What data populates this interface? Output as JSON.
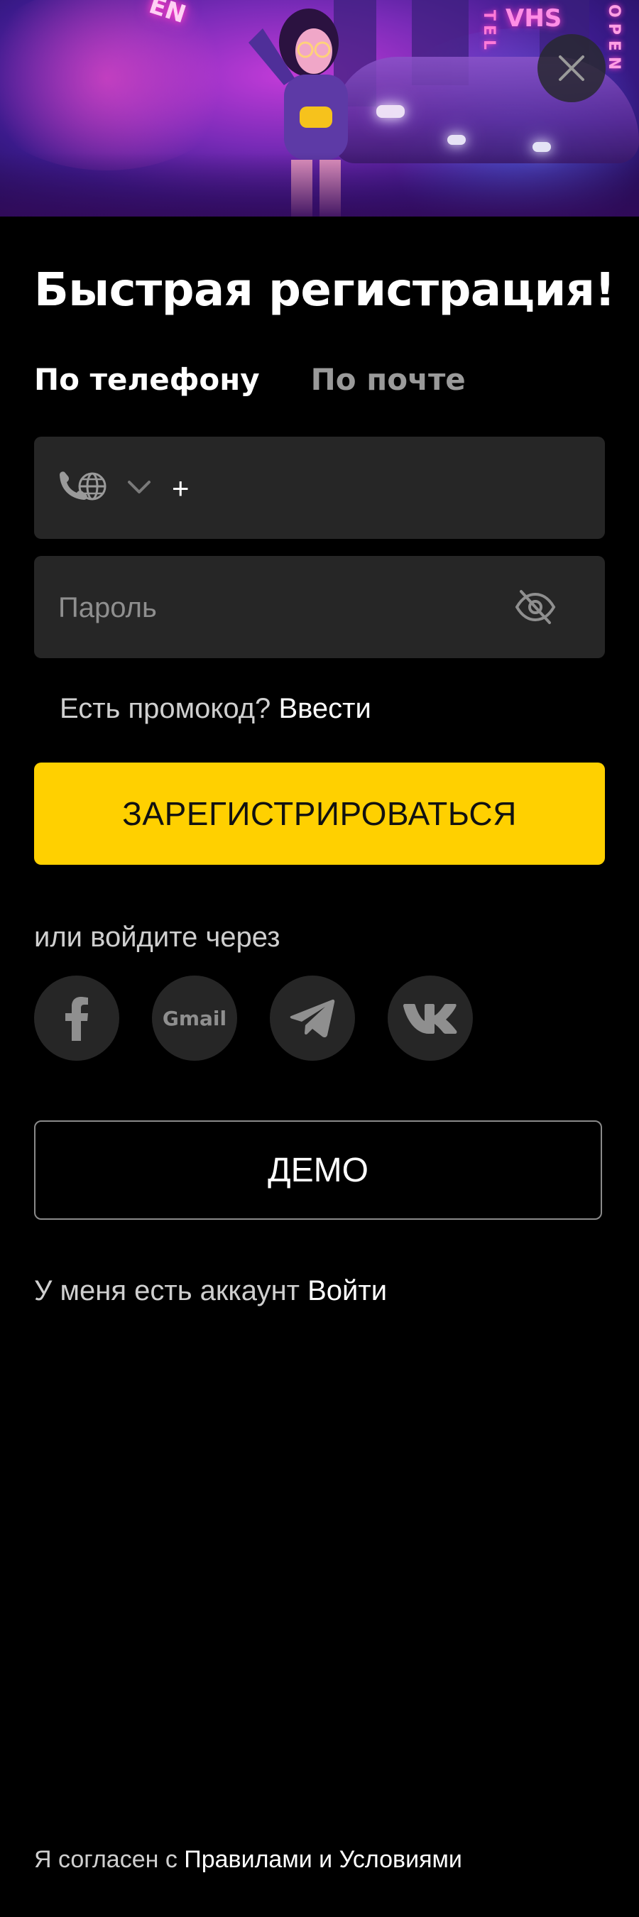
{
  "banner": {
    "neon_signs": [
      "EN",
      "VHS",
      "TEL",
      "OPEN"
    ]
  },
  "form": {
    "title": "Быстрая регистрация!",
    "tabs": [
      {
        "label": "По телефону",
        "active": true
      },
      {
        "label": "По почте",
        "active": false
      }
    ],
    "phone": {
      "value": "+",
      "icon": "phone-globe-icon"
    },
    "password": {
      "placeholder": "Пароль",
      "icon": "eye-off-icon"
    },
    "promo": {
      "question": "Есть промокод?",
      "link": "Ввести"
    },
    "register_label": "ЗАРЕГИСТРИРОВАТЬСЯ",
    "or_label": "или войдите через",
    "socials": [
      {
        "name": "facebook",
        "icon": "facebook-icon"
      },
      {
        "name": "gmail",
        "label": "Gmail",
        "icon": "gmail-icon"
      },
      {
        "name": "telegram",
        "icon": "telegram-icon"
      },
      {
        "name": "vk",
        "icon": "vk-icon"
      }
    ],
    "demo_label": "ДЕМО",
    "account": {
      "question": "У меня есть аккаунт",
      "link": "Войти"
    },
    "terms": {
      "prefix": "Я согласен с",
      "link": "Правилами и Условиями"
    }
  },
  "colors": {
    "accent": "#ffd000",
    "field_bg": "#262626",
    "background": "#000000"
  }
}
